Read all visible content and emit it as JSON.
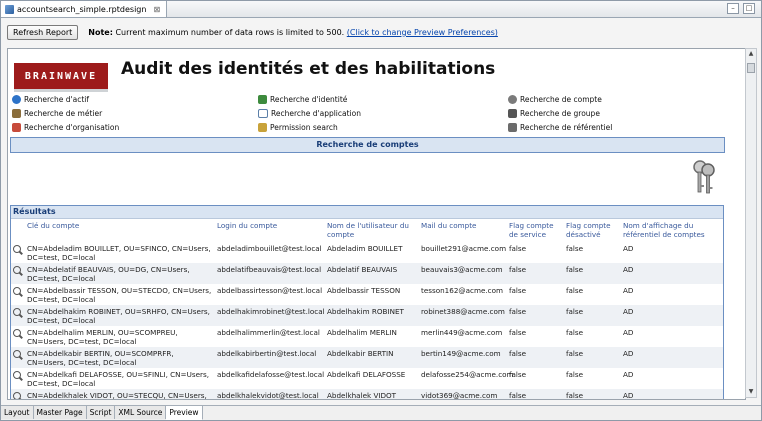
{
  "editor_tab": {
    "label": "accountsearch_simple.rptdesign",
    "close": "⊠"
  },
  "toolbar": {
    "refresh_label": "Refresh Report",
    "note_label": "Note:",
    "note_text": "Current maximum number of data rows is limited to 500.",
    "note_link": "(Click to change Preview Preferences)"
  },
  "report": {
    "logo_text": "BRAINWAVE",
    "title": "Audit des identités et des habilitations",
    "nav": [
      {
        "label": "Recherche d'actif",
        "color": "#2d73c8"
      },
      {
        "label": "Recherche de métier",
        "color": "#8a6d3b"
      },
      {
        "label": "Recherche d'organisation",
        "color": "#c74b3b"
      },
      {
        "label": "Recherche d'identité",
        "color": "#3d8b3d"
      },
      {
        "label": "Recherche d'application",
        "color": "#5b7fa8"
      },
      {
        "label": "Permission search",
        "color": "#c8a23a"
      },
      {
        "label": "Recherche de compte",
        "color": "#7b7b7b"
      },
      {
        "label": "Recherche de groupe",
        "color": "#555555"
      },
      {
        "label": "Recherche de référentiel",
        "color": "#6b6b6b"
      }
    ],
    "section_title": "Recherche de comptes",
    "results_title": "Résultats",
    "columns": [
      "Clé du compte",
      "Login du compte",
      "Nom de l'utilisateur du compte",
      "Mail du compte",
      "Flag compte de service",
      "Flag compte désactivé",
      "Nom d'affichage du référentiel de comptes"
    ],
    "rows": [
      [
        "CN=Abdeladim BOUILLET, OU=SFINCO, CN=Users, DC=test, DC=local",
        "abdeladimbouillet@test.local",
        "Abdeladim BOUILLET",
        "bouillet291@acme.com",
        "false",
        "false",
        "AD"
      ],
      [
        "CN=Abdelatif BEAUVAIS, OU=DG, CN=Users, DC=test, DC=local",
        "abdelatifbeauvais@test.local",
        "Abdelatif BEAUVAIS",
        "beauvais3@acme.com",
        "false",
        "false",
        "AD"
      ],
      [
        "CN=Abdelbassir TESSON, OU=STECDO, CN=Users, DC=test, DC=local",
        "abdelbassirtesson@test.local",
        "Abdelbassir TESSON",
        "tesson162@acme.com",
        "false",
        "false",
        "AD"
      ],
      [
        "CN=Abdelhakim ROBINET, OU=SRHFO, CN=Users, DC=test, DC=local",
        "abdelhakimrobinet@test.local",
        "Abdelhakim ROBINET",
        "robinet388@acme.com",
        "false",
        "false",
        "AD"
      ],
      [
        "CN=Abdelhalim MERLIN, OU=SCOMPREU, CN=Users, DC=test, DC=local",
        "abdelhalimmerlin@test.local",
        "Abdelhalim MERLIN",
        "merlin449@acme.com",
        "false",
        "false",
        "AD"
      ],
      [
        "CN=Abdelkabir BERTIN, OU=SCOMPRFR, CN=Users, DC=test, DC=local",
        "abdelkabirbertin@test.local",
        "Abdelkabir BERTIN",
        "bertin149@acme.com",
        "false",
        "false",
        "AD"
      ],
      [
        "CN=Abdelkafi DELAFOSSE, OU=SFINLI, CN=Users, DC=test, DC=local",
        "abdelkafidelafosse@test.local",
        "Abdelkafi DELAFOSSE",
        "delafosse254@acme.com",
        "false",
        "false",
        "AD"
      ],
      [
        "CN=Abdelkhalek VIDOT, OU=STECQU, CN=Users, DC=test, DC=local",
        "abdelkhalekvidot@test.local",
        "Abdelkhalek VIDOT",
        "vidot369@acme.com",
        "false",
        "false",
        "AD"
      ]
    ]
  },
  "bottom_tabs": [
    "Layout",
    "Master Page",
    "Script",
    "XML Source",
    "Preview"
  ],
  "active_bottom_tab": "Preview"
}
